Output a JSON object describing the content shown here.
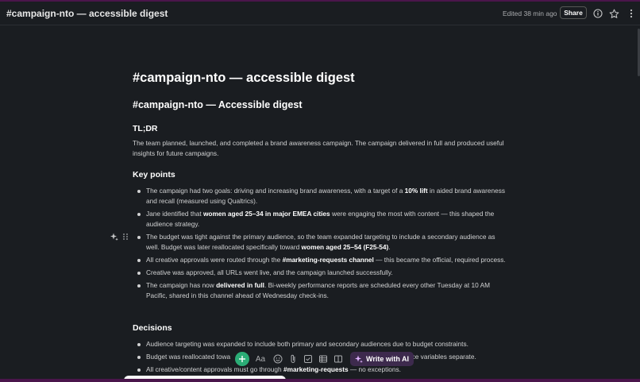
{
  "header": {
    "title": "#campaign-nto — accessible digest",
    "edited": "Edited 38 min ago",
    "share_label": "Share"
  },
  "doc": {
    "title": "#campaign-nto — accessible digest",
    "subtitle": "#campaign-nto — Accessible digest",
    "tldr_heading": "TL;DR",
    "tldr_text": "The team planned, launched, and completed a brand awareness campaign. The campaign delivered in full and produced useful insights for future campaigns.",
    "keypoints_heading": "Key points",
    "keypoints": [
      {
        "pre": "The campaign had two goals: driving and increasing brand awareness, with a target of a ",
        "bold": "10% lift",
        "post": " in aided brand awareness and recall (measured using Qualtrics)."
      },
      {
        "pre": "Jane identified that ",
        "bold": "women aged 25–34 in major EMEA cities",
        "post": " were engaging the most with content — this shaped the audience strategy."
      },
      {
        "pre": "The budget was tight against the primary audience, so the team expanded targeting to include a secondary audience as well. Budget was later reallocated specifically toward ",
        "bold": "women aged 25–54 (F25-54)",
        "post": "."
      },
      {
        "pre": "All creative approvals were routed through the ",
        "bold": "#marketing-requests channel",
        "post": " — this became the official, required process."
      },
      {
        "pre": "Creative was approved, all URLs went live, and the campaign launched successfully.",
        "bold": "",
        "post": ""
      },
      {
        "pre": "The campaign has now ",
        "bold": "delivered in full",
        "post": ". Bi-weekly performance reports are scheduled every other Tuesday at 10 AM Pacific, shared in this channel ahead of Wednesday check-ins."
      }
    ],
    "decisions_heading": "Decisions",
    "decisions": [
      {
        "pre": "Audience targeting was expanded to include both primary and secondary audiences due to budget constraints.",
        "bold": "",
        "post": ""
      },
      {
        "pre": "Budget was reallocated towa",
        "bold": "",
        "post": "",
        "tail": "nce variables separate."
      },
      {
        "pre": "All creative/content approvals must go through ",
        "bold": "#marketing-requests",
        "post": " — no exceptions."
      }
    ]
  },
  "toolbar": {
    "ai_label": "Write with AI",
    "text_format_label": "Aa"
  },
  "icons": {
    "info": "info-icon",
    "star": "star-icon",
    "more": "more-vertical-icon",
    "plus": "plus-icon",
    "emoji": "emoji-icon",
    "attach": "paperclip-icon",
    "checklist": "checkbox-icon",
    "table": "table-icon",
    "columns": "columns-icon",
    "sparkle": "sparkle-icon",
    "drag": "drag-handle-icon"
  },
  "colors": {
    "background": "#1a1d21",
    "accent_purple": "#4a154b",
    "plus_green": "#2bac76",
    "ai_button": "#3d2a4d"
  }
}
